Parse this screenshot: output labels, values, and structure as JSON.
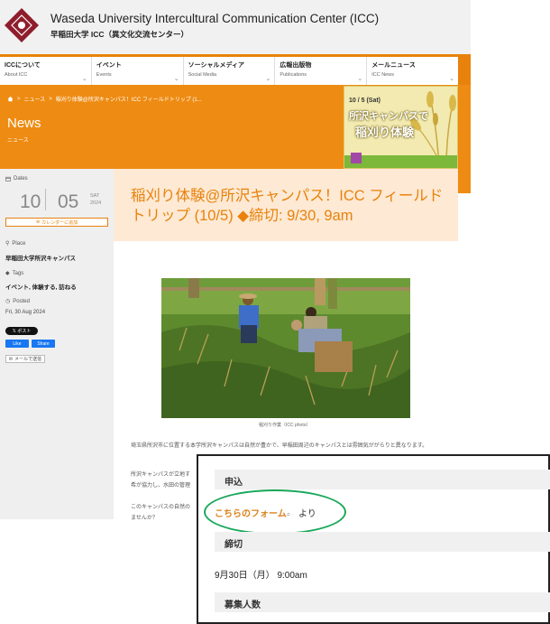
{
  "header": {
    "title": "Waseda University Intercultural Communication Center (ICC)",
    "subtitle": "早稲田大学 ICC（異文化交流センター）",
    "logo_icon": "waseda-emblem-icon"
  },
  "nav": [
    {
      "jp": "ICCについて",
      "en": "About ICC"
    },
    {
      "jp": "イベント",
      "en": "Events"
    },
    {
      "jp": "ソーシャルメディア",
      "en": "Social Media"
    },
    {
      "jp": "広報出版物",
      "en": "Publications"
    },
    {
      "jp": "メールニュース",
      "en": "ICC News"
    }
  ],
  "breadcrumb": {
    "home_icon": "home-icon",
    "items": [
      "ニュース",
      "稲刈り体験@所沢キャンパス！ICC フィールドトリップ (1..."
    ]
  },
  "section": {
    "title": "News",
    "subtitle": "ニュース"
  },
  "banner": {
    "date": "10 / 5 (Sat)",
    "line1": "所沢キャンパスで",
    "line2": "稲刈り体験"
  },
  "sidebar": {
    "dates_label": "Dates",
    "month": "10",
    "day": "05",
    "dow": "SAT",
    "year": "2024",
    "calendar_button": "カレンダーに追加",
    "place_label": "Place",
    "place_value": "早稲田大学所沢キャンパス",
    "tags_label": "Tags",
    "tags_value": "イベント, 体験する, 訪ねる",
    "posted_label": "Posted",
    "posted_value": "Fri, 30 Aug 2024",
    "x_post": "ポスト",
    "fb_like": "Like",
    "fb_share": "Share",
    "mail_send": "メールで送信"
  },
  "article": {
    "title": "稲刈り体験@所沢キャンパス！ICC フィールドトリップ (10/5) ◆締切: 9/30, 9am",
    "photo_caption": "稲刈り作業（ICC photo）",
    "para1": "埼玉県所沢市に位置する本学所沢キャンパスは自然が豊かで、早稲田周辺のキャンパスとは雰囲気ががらりと異なります。",
    "para2": "所沢キャンパスが立地す",
    "para2b": "希が協力し、水田の管理",
    "para3": "このキャンパスの自然の",
    "para3b": "ませんか？"
  },
  "overlay": {
    "apply_label": "申込",
    "form_link": "こちらのフォーム",
    "form_tail": "より",
    "deadline_label": "締切",
    "deadline_value": "9月30日（月） 9:00am",
    "recruit_label": "募集人数"
  },
  "colors": {
    "accent": "#e8820c",
    "title_bg": "#fde9d4",
    "highlight": "#18a85a"
  }
}
